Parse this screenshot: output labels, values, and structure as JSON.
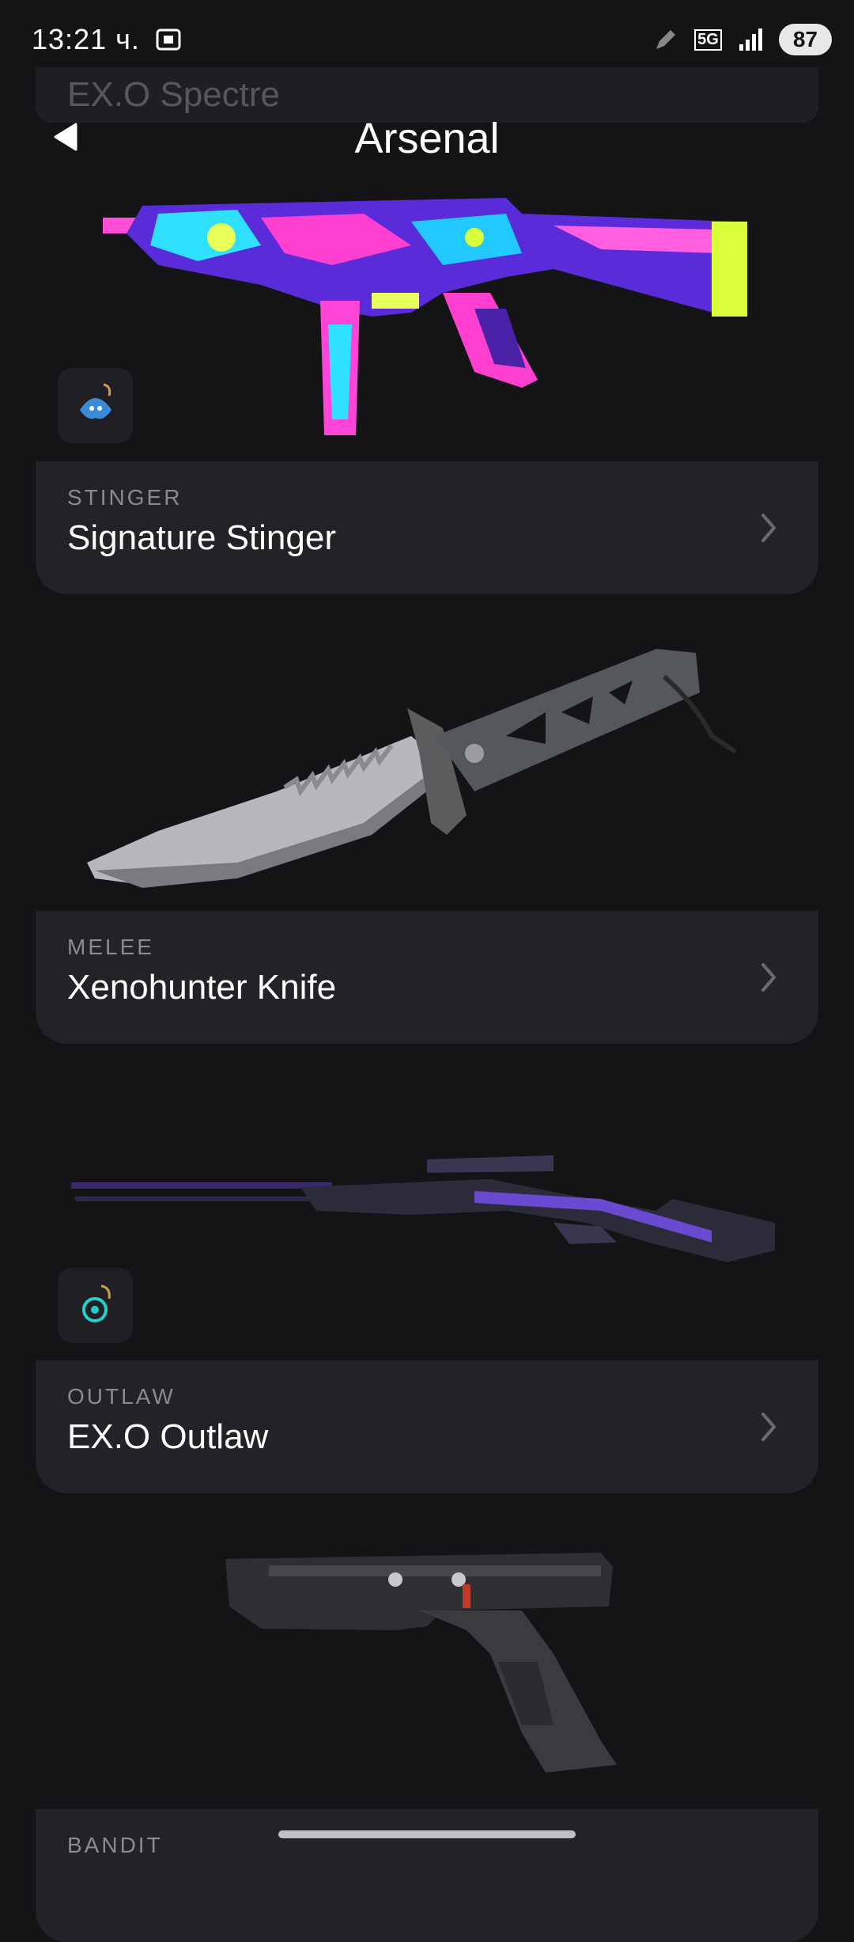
{
  "status": {
    "time": "13:21 ч.",
    "battery": "87",
    "network": "5G"
  },
  "ghost_title": "EX.O Spectre",
  "header": {
    "title": "Arsenal"
  },
  "items": [
    {
      "category": "STINGER",
      "name": "Signature Stinger"
    },
    {
      "category": "MELEE",
      "name": "Xenohunter Knife"
    },
    {
      "category": "OUTLAW",
      "name": "EX.O Outlaw"
    },
    {
      "category": "BANDIT"
    }
  ],
  "colors": {
    "background": "#141417",
    "card": "#222227",
    "category_text": "#8a8a92"
  }
}
